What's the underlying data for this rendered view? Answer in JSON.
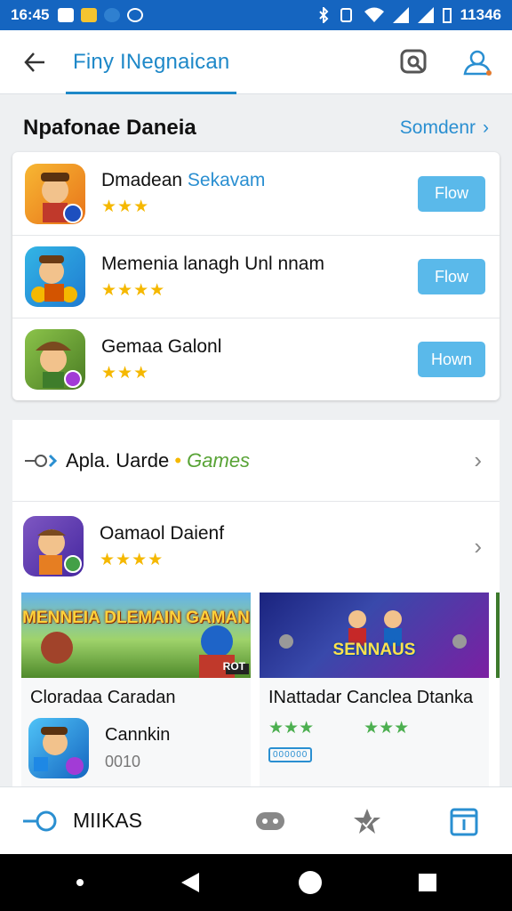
{
  "status_bar": {
    "time": "16:45",
    "battery": "11346"
  },
  "app_bar": {
    "title": "Finy INegnaican"
  },
  "top_section": {
    "heading": "Npafonae Daneia",
    "more_link": "Somdenr",
    "items": [
      {
        "name_main": "Dmadean ",
        "name_accent": "Sekavam",
        "stars": "★★★",
        "button": "Flow"
      },
      {
        "name_main": "Memenia lanagh Unl nnam",
        "name_accent": "",
        "stars": "★★★★",
        "button": "Flow"
      },
      {
        "name_main": "Gemaa Galonl",
        "name_accent": "",
        "stars": "★★★",
        "button": "Hown"
      }
    ]
  },
  "games_section": {
    "label_main": "Apla. Uarde",
    "label_accent": "Games",
    "featured": {
      "name": "Oamaol Daienf",
      "stars": "★★★★"
    },
    "banners": [
      {
        "art_title": "MENNEIA DLEMAIN GAMAN",
        "caption": "Cloradaa Caradan",
        "app_name": "Cannkin",
        "app_sub": "0010",
        "badge": "ROT"
      },
      {
        "art_title": "SENNAUS",
        "caption": "INattadar Canclea Dtanka",
        "stars_a": "★★★",
        "stars_b": "★★★",
        "tag": "000000"
      }
    ]
  },
  "bottom_nav": {
    "home_label": "MIIKAS"
  },
  "colors": {
    "primary": "#1565c0",
    "accent": "#1e88c8",
    "button": "#5ab9ea",
    "star": "#f5b800",
    "games_green": "#58a335"
  }
}
